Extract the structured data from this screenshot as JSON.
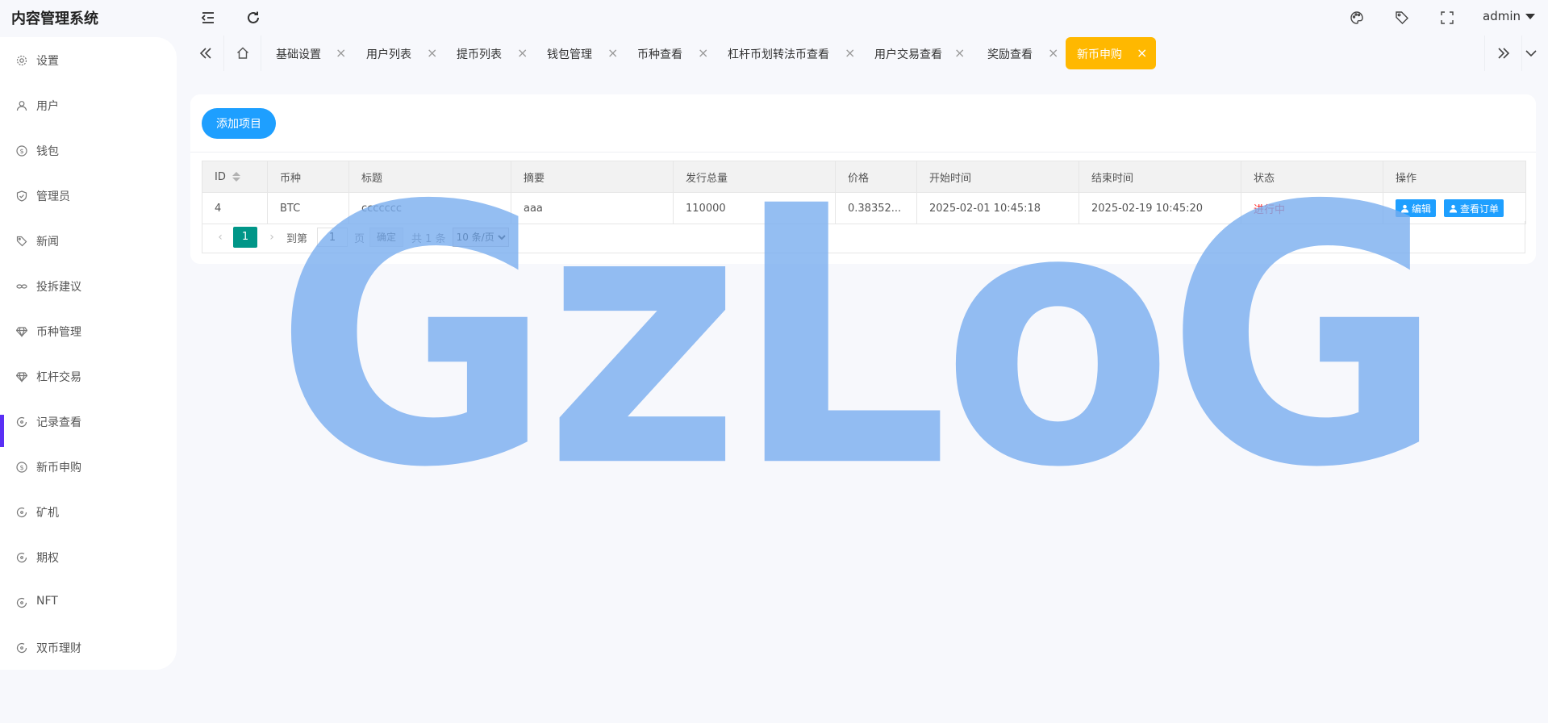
{
  "header": {
    "app_title": "内容管理系统",
    "user_name": "admin",
    "icons": [
      "menu-fold-icon",
      "refresh-icon",
      "theme-palette-icon",
      "tag-icon",
      "fullscreen-icon"
    ]
  },
  "sidebar": {
    "active_index": 8,
    "items": [
      {
        "label": "设置",
        "icon": "gear-icon"
      },
      {
        "label": "用户",
        "icon": "user-icon"
      },
      {
        "label": "钱包",
        "icon": "dollar-circle-icon"
      },
      {
        "label": "管理员",
        "icon": "shield-icon"
      },
      {
        "label": "新闻",
        "icon": "tag-icon"
      },
      {
        "label": "投拆建议",
        "icon": "link-icon"
      },
      {
        "label": "币种管理",
        "icon": "diamond-icon"
      },
      {
        "label": "杠杆交易",
        "icon": "diamond-icon"
      },
      {
        "label": "记录查看",
        "icon": "clock-circle-icon"
      },
      {
        "label": "新币申购",
        "icon": "dollar-circle-icon"
      },
      {
        "label": "矿机",
        "icon": "clock-circle-icon"
      },
      {
        "label": "期权",
        "icon": "clock-circle-icon"
      },
      {
        "label": "NFT",
        "icon": "clock-circle-icon"
      },
      {
        "label": "双币理财",
        "icon": "clock-circle-icon"
      }
    ]
  },
  "tabs": {
    "items": [
      {
        "label": "基础设置"
      },
      {
        "label": "用户列表"
      },
      {
        "label": "提币列表"
      },
      {
        "label": "钱包管理"
      },
      {
        "label": "币种查看"
      },
      {
        "label": "杠杆币划转法币查看"
      },
      {
        "label": "用户交易查看"
      },
      {
        "label": "奖励查看"
      },
      {
        "label": "新币申购",
        "active": true
      }
    ],
    "close_glyph": "×"
  },
  "toolbar": {
    "add_label": "添加项目"
  },
  "table": {
    "columns": [
      "ID",
      "币种",
      "标题",
      "摘要",
      "发行总量",
      "价格",
      "开始时间",
      "结束时间",
      "状态",
      "操作"
    ],
    "rows": [
      {
        "id": "4",
        "coin": "BTC",
        "title": "ccccccc",
        "summary": "aaa",
        "total": "110000",
        "price": "0.38352...",
        "start": "2025-02-01 10:45:18",
        "end": "2025-02-19 10:45:20",
        "status": "进行中",
        "actions": [
          "编辑",
          "查看订单"
        ]
      }
    ]
  },
  "pager": {
    "current_page": "1",
    "goto_label": "到第",
    "goto_value": "1",
    "page_unit": "页",
    "confirm_label": "确定",
    "total_label": "共 1 条",
    "page_size": "10 条/页"
  },
  "watermark": "GzLoG",
  "colors": {
    "primary": "#1e9fff",
    "active_tab": "#ffb800",
    "pager_current": "#009688",
    "status_running": "#ff1f1f",
    "sidebar_active": "#5a2ff5",
    "watermark": "#7aaef0"
  }
}
